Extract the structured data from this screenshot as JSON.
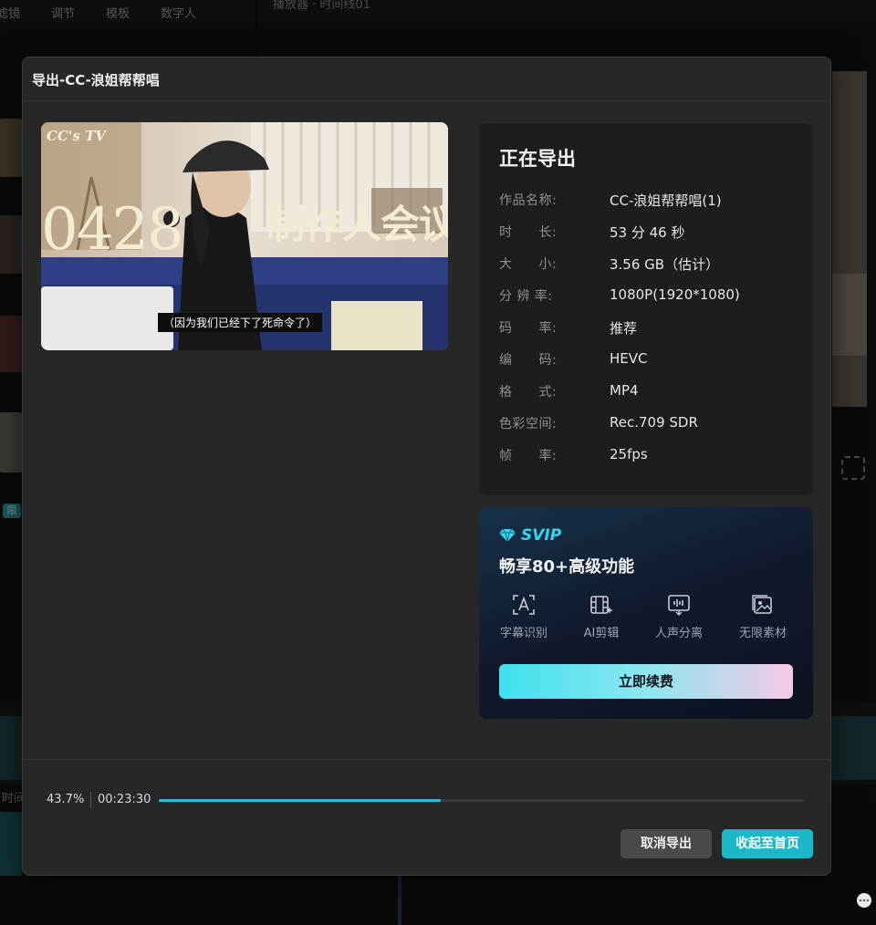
{
  "background_app": {
    "toolbar_tabs": [
      "滤镜",
      "调节",
      "模板",
      "数字人"
    ],
    "player_title": "播放器 · 时间线01",
    "badge": "限",
    "timeline_label": "时间"
  },
  "dialog": {
    "title": "导出-CC-浪姐帮帮唱",
    "preview": {
      "watermark": "CC's TV",
      "date_text": "0428",
      "headline": "制作人会议",
      "subtitle": "（因为我们已经下了死命令了）"
    },
    "info": {
      "heading": "正在导出",
      "rows": [
        {
          "label": "作品名称:",
          "value": "CC-浪姐帮帮唱(1)"
        },
        {
          "label": "时　　长:",
          "value": "53 分 46 秒"
        },
        {
          "label": "大　　小:",
          "value": "3.56 GB（估计）"
        },
        {
          "label": "分 辨 率:",
          "value": "1080P(1920*1080)"
        },
        {
          "label": "码　　率:",
          "value": "推荐"
        },
        {
          "label": "编　　码:",
          "value": "HEVC"
        },
        {
          "label": "格　　式:",
          "value": "MP4"
        },
        {
          "label": "色彩空间:",
          "value": "Rec.709 SDR"
        },
        {
          "label": "帧　　率:",
          "value": "25fps"
        }
      ]
    },
    "svip": {
      "badge": "SVIP",
      "headline": "畅享80+高级功能",
      "features": [
        {
          "label": "字幕识别",
          "icon": "subtitle-recognition-icon"
        },
        {
          "label": "AI剪辑",
          "icon": "ai-edit-icon"
        },
        {
          "label": "人声分离",
          "icon": "voice-separation-icon"
        },
        {
          "label": "无限素材",
          "icon": "unlimited-assets-icon"
        }
      ],
      "renew_button": "立即续费"
    },
    "progress": {
      "percent_text": "43.7%",
      "percent_value": 0.437,
      "elapsed": "00:23:30"
    },
    "buttons": {
      "cancel": "取消导出",
      "collapse": "收起至首页"
    }
  },
  "colors": {
    "accent": "#1ab8c8",
    "svip": "#34d7f0",
    "dialog_bg": "#272727",
    "card_bg": "#1d1d1d"
  }
}
